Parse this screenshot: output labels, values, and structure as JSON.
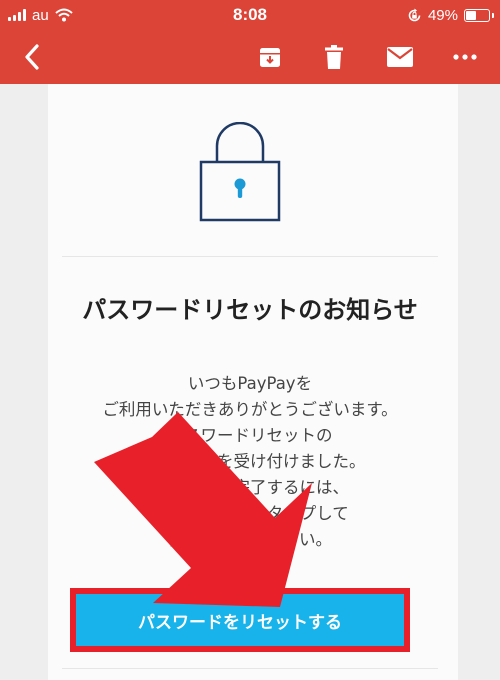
{
  "status_bar": {
    "carrier": "au",
    "time": "8:08",
    "battery": "49%",
    "battery_level": 0.49
  },
  "toolbar": {
    "icons": [
      "back-icon",
      "archive-icon",
      "trash-icon",
      "mail-icon",
      "more-icon"
    ]
  },
  "email": {
    "title": "パスワードリセットのお知らせ",
    "body_lines": [
      "いつもPayPayを",
      "ご利用いただきありがとうございます。",
      "パスワードリセットの",
      "リクエストを受け付けました。",
      "リセットを完了するには、",
      "以下のボタンをタップして",
      "再設定してください。"
    ],
    "button_label": "パスワードをリセットする"
  },
  "colors": {
    "header_red": "#db4437",
    "button_blue": "#17b3ea",
    "annotation_red": "#e8202a",
    "lock_navy": "#1f3a64",
    "keyhole_blue": "#1c9ad6"
  }
}
